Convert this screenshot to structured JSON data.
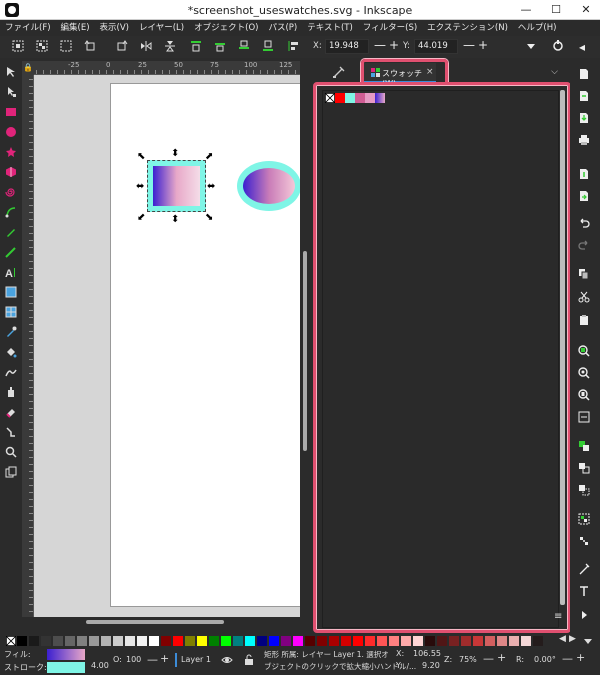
{
  "window": {
    "title": "*screenshot_useswatches.svg - Inkscape",
    "minimize": "—",
    "maximize": "☐",
    "close": "✕"
  },
  "menu": [
    "ファイル(F)",
    "編集(E)",
    "表示(V)",
    "レイヤー(L)",
    "オブジェクト(O)",
    "パス(P)",
    "テキスト(T)",
    "フィルター(S)",
    "エクステンション(N)",
    "ヘルプ(H)"
  ],
  "toolbar": {
    "x_label": "X:",
    "x_value": "19.948",
    "y_label": "Y:",
    "y_value": "44.019",
    "minus": "—",
    "plus": "+"
  },
  "ruler": {
    "h_labels": [
      "-25",
      "0",
      "25",
      "50",
      "75",
      "100",
      "125"
    ]
  },
  "panel": {
    "tab_label": "スウォッチ(W)",
    "tab_close": "×",
    "dropdown": "⌵",
    "menu_icon": "≡"
  },
  "swatches": [
    {
      "color": "none"
    },
    {
      "color": "#ff0000"
    },
    {
      "color": "#7ff5e6"
    },
    {
      "color": "#d05d94"
    },
    {
      "color": "#e69ac4"
    },
    {
      "color": "gradient"
    }
  ],
  "palette": {
    "colors": [
      "#000000",
      "#1a1a1a",
      "#333333",
      "#4d4d4d",
      "#666666",
      "#808080",
      "#999999",
      "#b3b3b3",
      "#cccccc",
      "#e6e6e6",
      "#f2f2f2",
      "#ffffff",
      "#800000",
      "#ff0000",
      "#808000",
      "#ffff00",
      "#008000",
      "#00ff00",
      "#008080",
      "#00ffff",
      "#000080",
      "#0000ff",
      "#800080",
      "#ff00ff",
      "#550000",
      "#800000",
      "#aa0000",
      "#d40000",
      "#ff0000",
      "#ff2a2a",
      "#ff5555",
      "#ff8080",
      "#ffaaaa",
      "#ffd5d5",
      "#280b0b",
      "#501616",
      "#782121",
      "#a02c2c",
      "#c83737",
      "#d35f5f",
      "#de8787",
      "#e9afaf",
      "#f4d7d7",
      "#241c1c"
    ],
    "left_arrow": "◀",
    "right_arrow": "▶"
  },
  "status": {
    "fill_label": "フィル:",
    "stroke_label": "ストローク:",
    "stroke_width": "4.00",
    "opacity_label": "O:",
    "opacity_value": "100",
    "layer": "Layer 1",
    "message_line1": "矩形 所属: レイヤー Layer 1. 選択オ",
    "message_line2": "ブジェクトのクリックで拡大縮小ハンドル/...",
    "cursor_x_label": "X:",
    "cursor_x": "106.55",
    "cursor_y_label": "Y:",
    "cursor_y": "9.20",
    "zoom_label": "Z:",
    "zoom": "75%",
    "rotation_label": "R:",
    "rotation": "0.00°",
    "minus": "—",
    "plus": "+"
  }
}
